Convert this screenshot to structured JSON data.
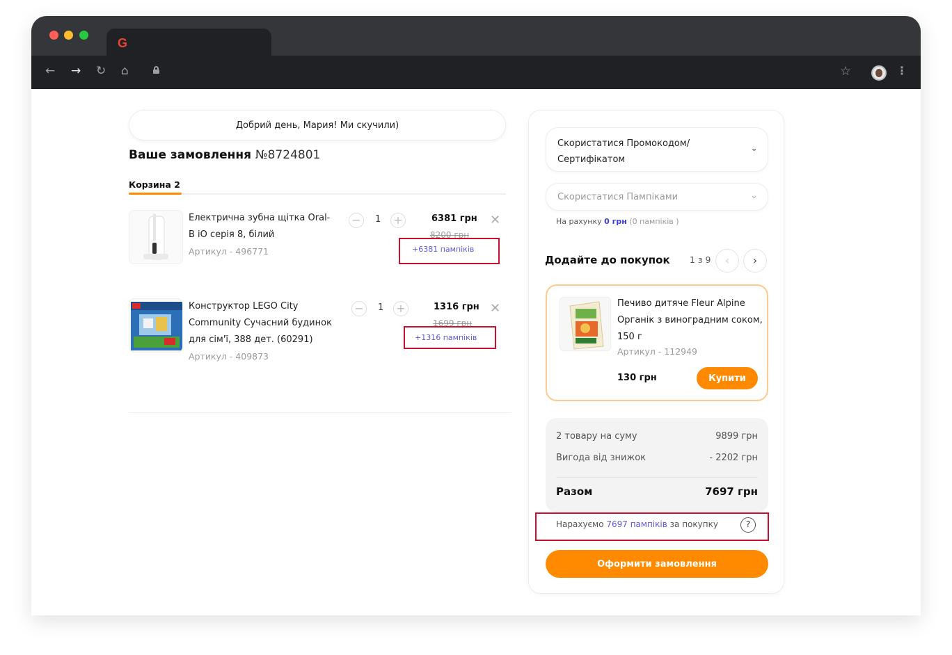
{
  "browser": {
    "tab_favicon": "G"
  },
  "greeting": "Добрий день, Мария! Ми скучили)",
  "order": {
    "title": "Ваше замовлення",
    "number": "№8724801"
  },
  "cart_tab": "Корзина 2",
  "items": [
    {
      "name": "Електрична зубна щітка Oral-B iO серія 8, білий",
      "sku": "Артикул - 496771",
      "qty": "1",
      "price": "6381 грн",
      "old_price": "8200 грн",
      "points": "+6381 пампіків"
    },
    {
      "name": "Конструктор LEGO City Community Сучасний будинок для сім'ї, 388 дет. (60291)",
      "sku": "Артикул - 409873",
      "qty": "1",
      "price": "1316 грн",
      "old_price": "1699 грн",
      "points": "+1316 пампіків"
    }
  ],
  "promo": {
    "label": "Скористатися Промокодом/Сертифікатом"
  },
  "pampiks": {
    "label": "Скористатися Пампіками",
    "balance_prefix": "На рахунку",
    "balance_value": "0 грн",
    "balance_suffix": "(0 пампіків )"
  },
  "recommend": {
    "title": "Додайте до покупок",
    "counter": "1 з 9",
    "product": {
      "name": "Печиво дитяче Fleur Alpine Органік з виноградним соком, 150 г",
      "sku": "Артикул - 112949",
      "price": "130 грн",
      "buy_label": "Купити"
    }
  },
  "summary": {
    "items_label": "2 товару на суму",
    "items_value": "9899 грн",
    "discount_label": "Вигода від знижок",
    "discount_value": "- 2202 грн",
    "total_label": "Разом",
    "total_value": "7697 грн"
  },
  "accrual": {
    "prefix": "Нарахуємо",
    "points": "7697 пампіків",
    "suffix": "за покупку"
  },
  "checkout_label": "Оформити замовлення",
  "colors": {
    "accent": "#ff8a00",
    "points": "#5a5ad8",
    "highlight_box": "#c8102e"
  }
}
